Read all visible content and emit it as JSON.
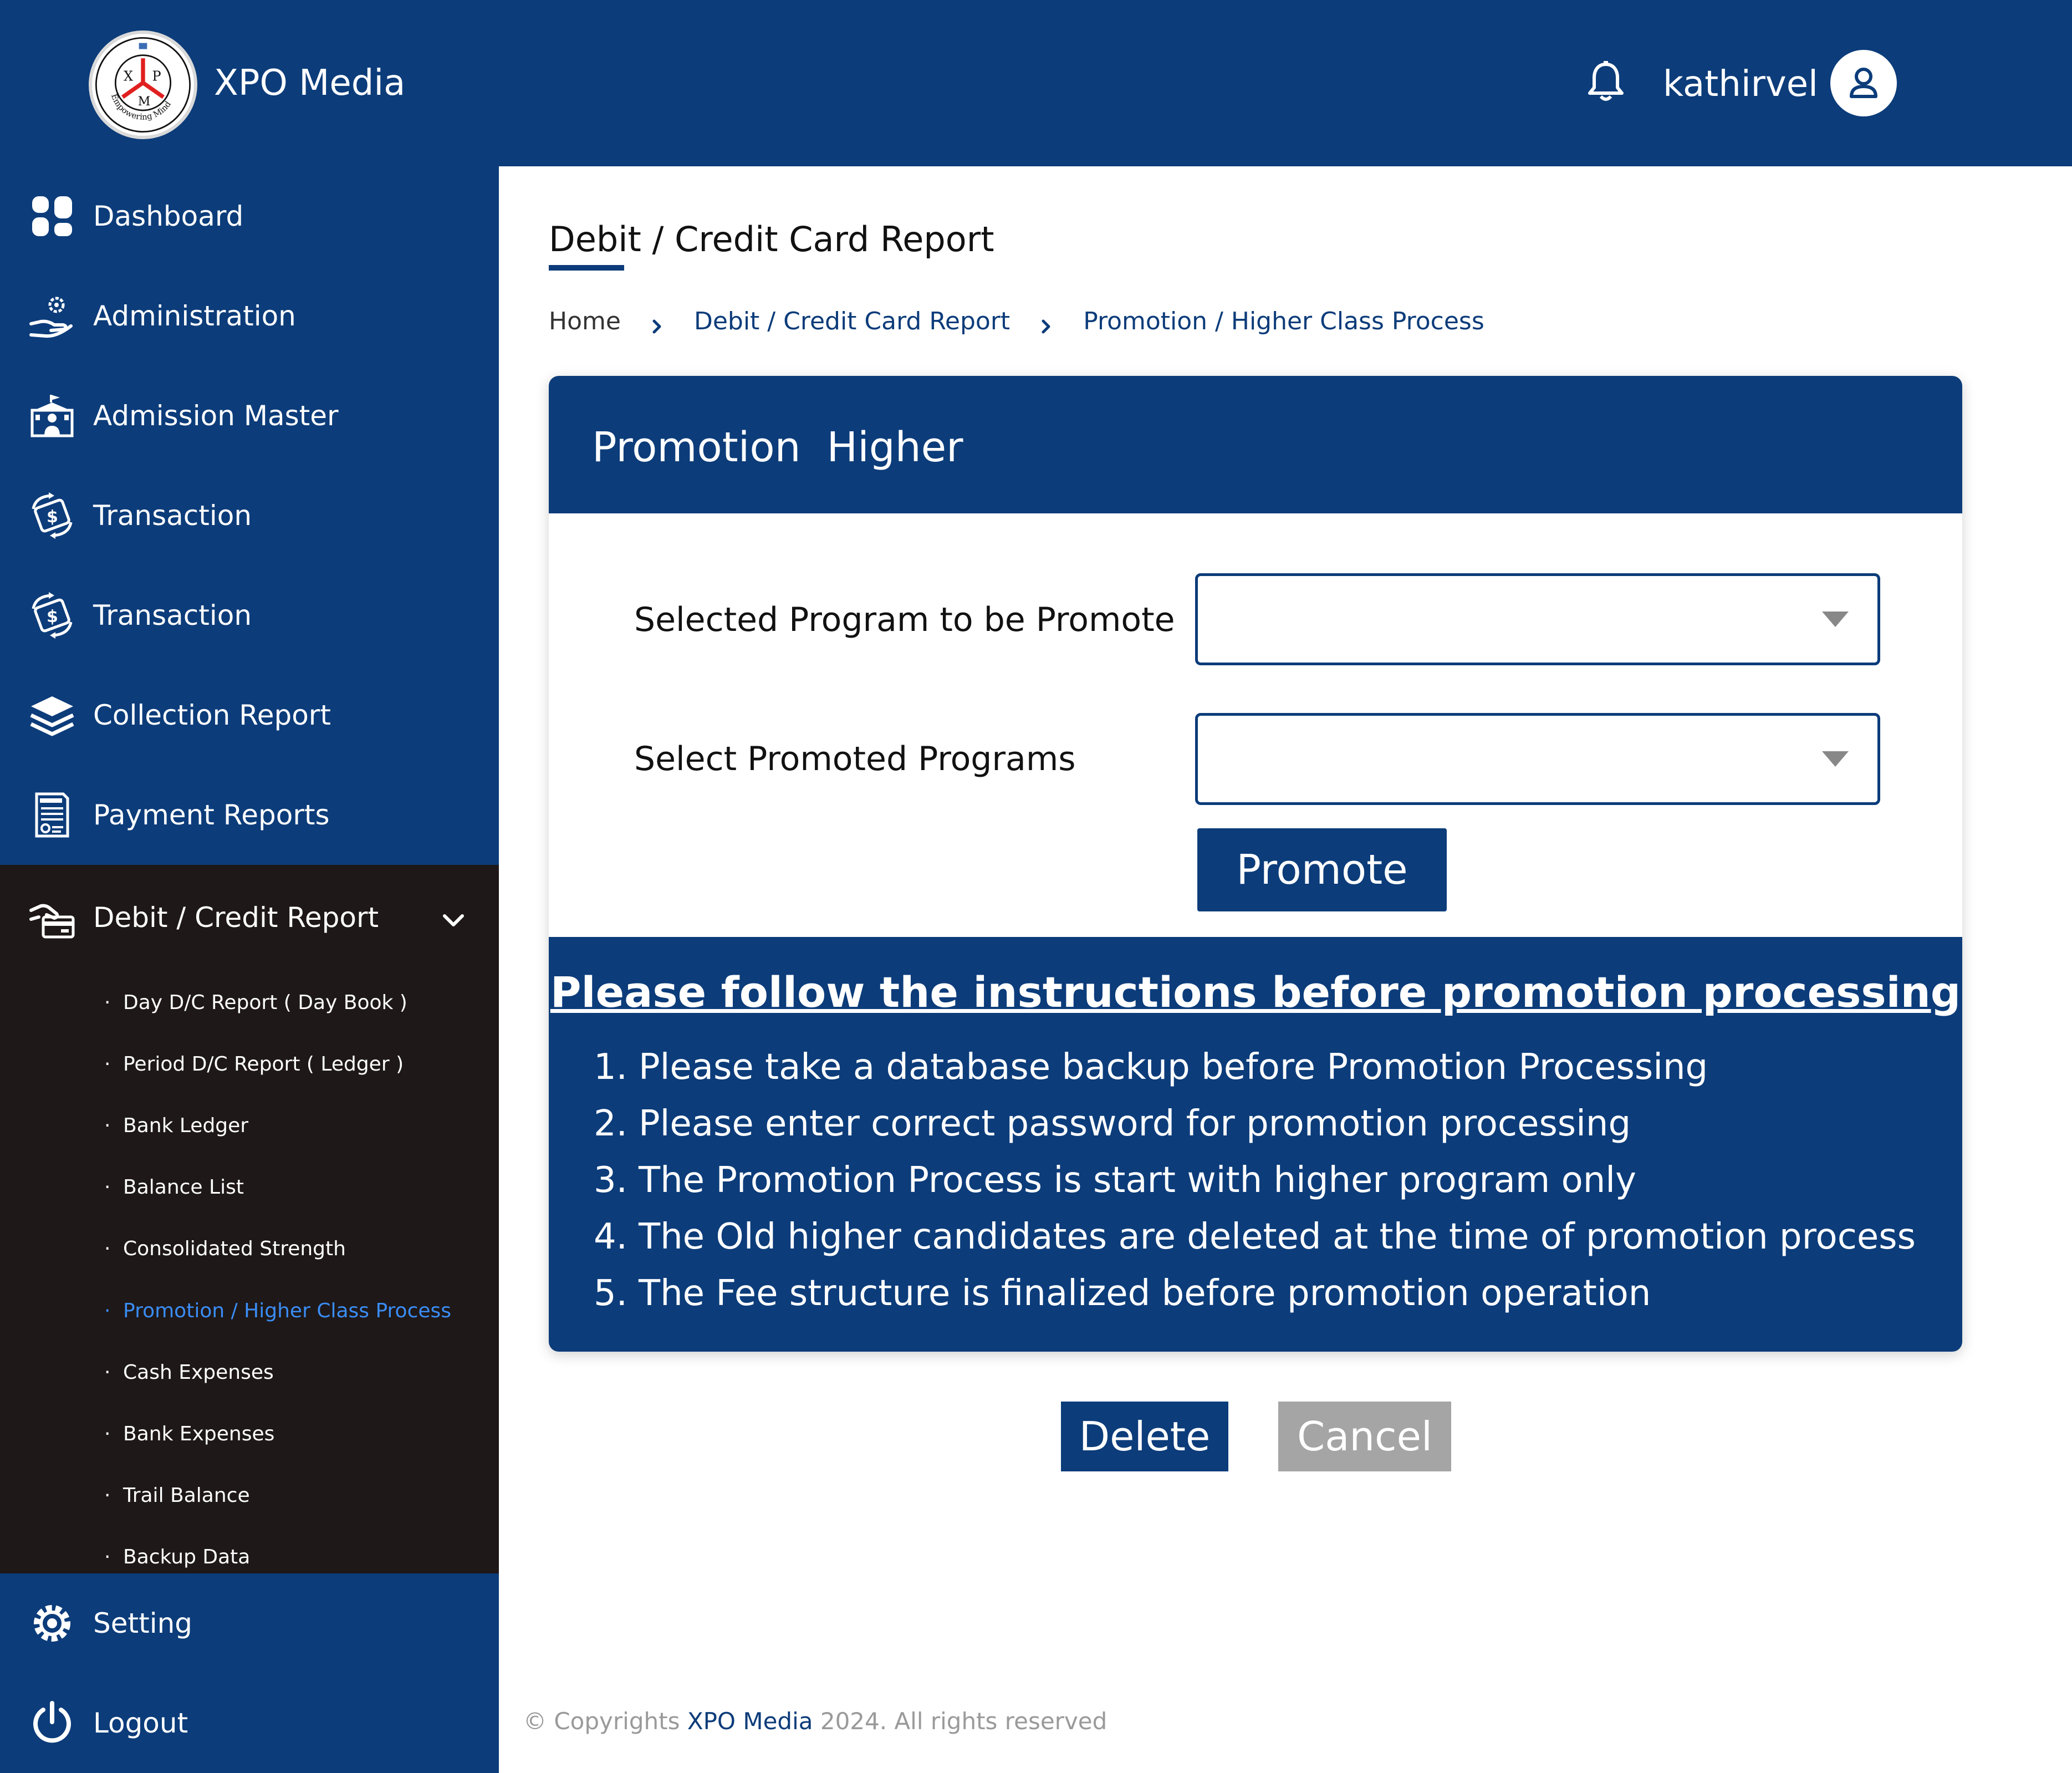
{
  "header": {
    "brand": "XPO Media",
    "logo": {
      "letters": [
        "X",
        "P",
        "M"
      ],
      "motto": "Empowering Mind"
    },
    "username": "kathirvel"
  },
  "icons": {
    "bell": "bell-icon",
    "user": "user-icon",
    "chevron": "chevron-down-icon",
    "breadcrumb_separator": "chevron-right-icon"
  },
  "sidebar": {
    "items": [
      {
        "label": "Dashboard",
        "icon": "dashboard-icon"
      },
      {
        "label": "Administration",
        "icon": "admin-gear-hand-icon"
      },
      {
        "label": "Admission Master",
        "icon": "school-building-icon"
      },
      {
        "label": "Transaction",
        "icon": "money-exchange-icon"
      },
      {
        "label": "Transaction",
        "icon": "money-exchange-icon"
      },
      {
        "label": "Collection Report",
        "icon": "layers-icon"
      },
      {
        "label": "Payment Reports",
        "icon": "invoice-icon"
      }
    ],
    "expanded": {
      "label": "Debit / Credit Report",
      "icon": "card-payment-icon",
      "items": [
        "Day D/C Report ( Day Book )",
        "Period D/C Report ( Ledger )",
        "Bank Ledger",
        "Balance List",
        "Consolidated Strength",
        "Promotion / Higher Class Process",
        "Cash Expenses",
        "Bank Expenses",
        "Trail Balance",
        "Backup Data"
      ],
      "active_index": 5
    },
    "bottom_items": [
      {
        "label": "Setting",
        "icon": "gear-icon"
      },
      {
        "label": "Logout",
        "icon": "power-icon"
      }
    ]
  },
  "page": {
    "title": "Debit / Credit Card Report",
    "breadcrumb": [
      "Home",
      "Debit / Credit Card Report",
      "Promotion / Higher Class Process"
    ]
  },
  "panel": {
    "title": "Promotion  Higher",
    "fields": [
      {
        "label": "Selected Program to be Promote",
        "value": ""
      },
      {
        "label": "Select Promoted Programs",
        "value": ""
      }
    ],
    "promote_label": "Promote",
    "instructions_title": "Please follow the instructions before promotion processing",
    "instructions": [
      "Please take a database backup before Promotion Processing",
      "Please enter correct password for promotion processing",
      "The Promotion Process is start with higher program only",
      "The Old higher candidates are deleted at the time of promotion process",
      "The Fee structure is finalized before promotion operation"
    ]
  },
  "actions": {
    "delete_label": "Delete",
    "cancel_label": "Cancel"
  },
  "footer": {
    "prefix": "© Copyrights",
    "brand": "XPO Media",
    "suffix": "2024. All rights reserved"
  },
  "colors": {
    "primary": "#0c3c7a",
    "submenu_bg": "#1e1818",
    "active_link": "#3a8df5",
    "cancel_bg": "#a5a5a5",
    "logo_red": "#e02020"
  }
}
